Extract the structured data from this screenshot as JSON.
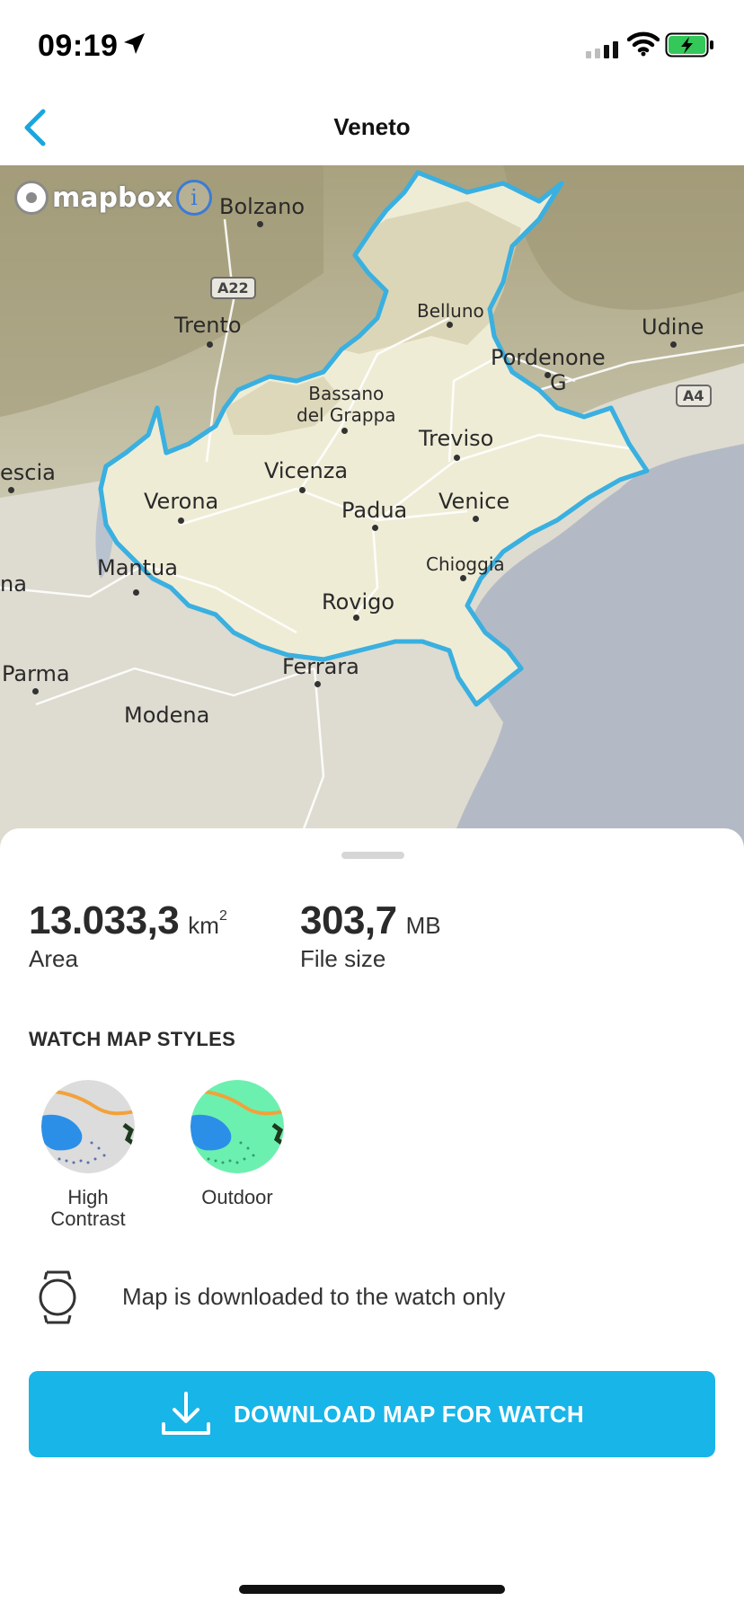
{
  "status_bar": {
    "time": "09:19",
    "icons": [
      "location-arrow-icon",
      "signal-icon",
      "wifi-icon",
      "battery-charging-icon"
    ],
    "battery_color": "#34c759"
  },
  "nav": {
    "back_icon": "chevron-left-icon",
    "title": "Veneto",
    "accent": "#1aa6dd"
  },
  "map": {
    "attribution": "mapbox",
    "info_icon": "info-icon",
    "region_outline_color": "#3ab0e0",
    "labels": {
      "bolzano": "Bolzano",
      "trento": "Trento",
      "belluno": "Belluno",
      "udine": "Udine",
      "pordenone": "Pordenone",
      "bassano": "Bassano\ndel Grappa",
      "treviso": "Treviso",
      "vicenza": "Vicenza",
      "verona": "Verona",
      "padua": "Padua",
      "venice": "Venice",
      "chioggia": "Chioggia",
      "mantua": "Mantua",
      "rovigo": "Rovigo",
      "ferrara": "Ferrara",
      "parma": "Parma",
      "modena": "Modena",
      "brescia_partial": "escia",
      "partial_left": "na",
      "partial_right": "G"
    },
    "road_badges": {
      "a22": "A22",
      "a4": "A4"
    }
  },
  "sheet": {
    "area": {
      "value": "13.033,3",
      "unit": "km",
      "unit_sup": "2",
      "label": "Area"
    },
    "file_size": {
      "value": "303,7",
      "unit": "MB",
      "label": "File size"
    },
    "styles_title": "WATCH MAP STYLES",
    "styles": [
      {
        "label_line1": "High",
        "label_line2": "Contrast"
      },
      {
        "label_line1": "Outdoor",
        "label_line2": ""
      }
    ],
    "info_text": "Map is downloaded to the watch only",
    "download_label": "DOWNLOAD MAP FOR WATCH",
    "download_color": "#18b5e8"
  }
}
